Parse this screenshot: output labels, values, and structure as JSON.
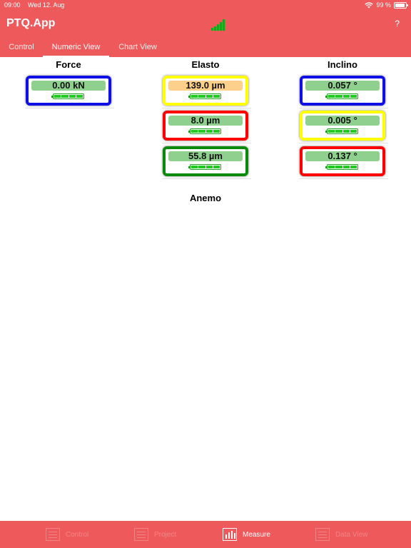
{
  "status": {
    "time": "09:00",
    "date": "Wed 12. Aug",
    "battery": "99 %"
  },
  "app": {
    "title": "PTQ.App",
    "help": "?"
  },
  "tabs": [
    {
      "label": "Control",
      "active": false
    },
    {
      "label": "Numeric View",
      "active": true
    },
    {
      "label": "Chart View",
      "active": false
    }
  ],
  "columns": {
    "force": {
      "title": "Force",
      "sensors": [
        {
          "value": "0.00 kN",
          "frame": "#1010e6",
          "pill": "#8fd08f"
        }
      ]
    },
    "elasto": {
      "title": "Elasto",
      "sensors": [
        {
          "value": "139.0 µm",
          "frame": "#ffff00",
          "pill": "#ffd08a"
        },
        {
          "value": "8.0 µm",
          "frame": "#ff0000",
          "pill": "#8fd08f"
        },
        {
          "value": "55.8 µm",
          "frame": "#0a8a0a",
          "pill": "#8fd08f"
        }
      ]
    },
    "inclino": {
      "title": "Inclino",
      "sensors": [
        {
          "value": "0.057 °",
          "frame": "#1010e6",
          "pill": "#8fd08f"
        },
        {
          "value": "0.005 °",
          "frame": "#ffff00",
          "pill": "#8fd08f"
        },
        {
          "value": "0.137 °",
          "frame": "#ff0000",
          "pill": "#8fd08f"
        }
      ]
    },
    "anemo": {
      "title": "Anemo"
    }
  },
  "bottom_nav": [
    {
      "label": "Control",
      "active": false
    },
    {
      "label": "Project",
      "active": false
    },
    {
      "label": "Measure",
      "active": true
    },
    {
      "label": "Data View",
      "active": false
    }
  ],
  "colors": {
    "bar": "#ee5a5c",
    "battery_green": "#1ecb1e",
    "signal_green": "#1aa61a"
  }
}
